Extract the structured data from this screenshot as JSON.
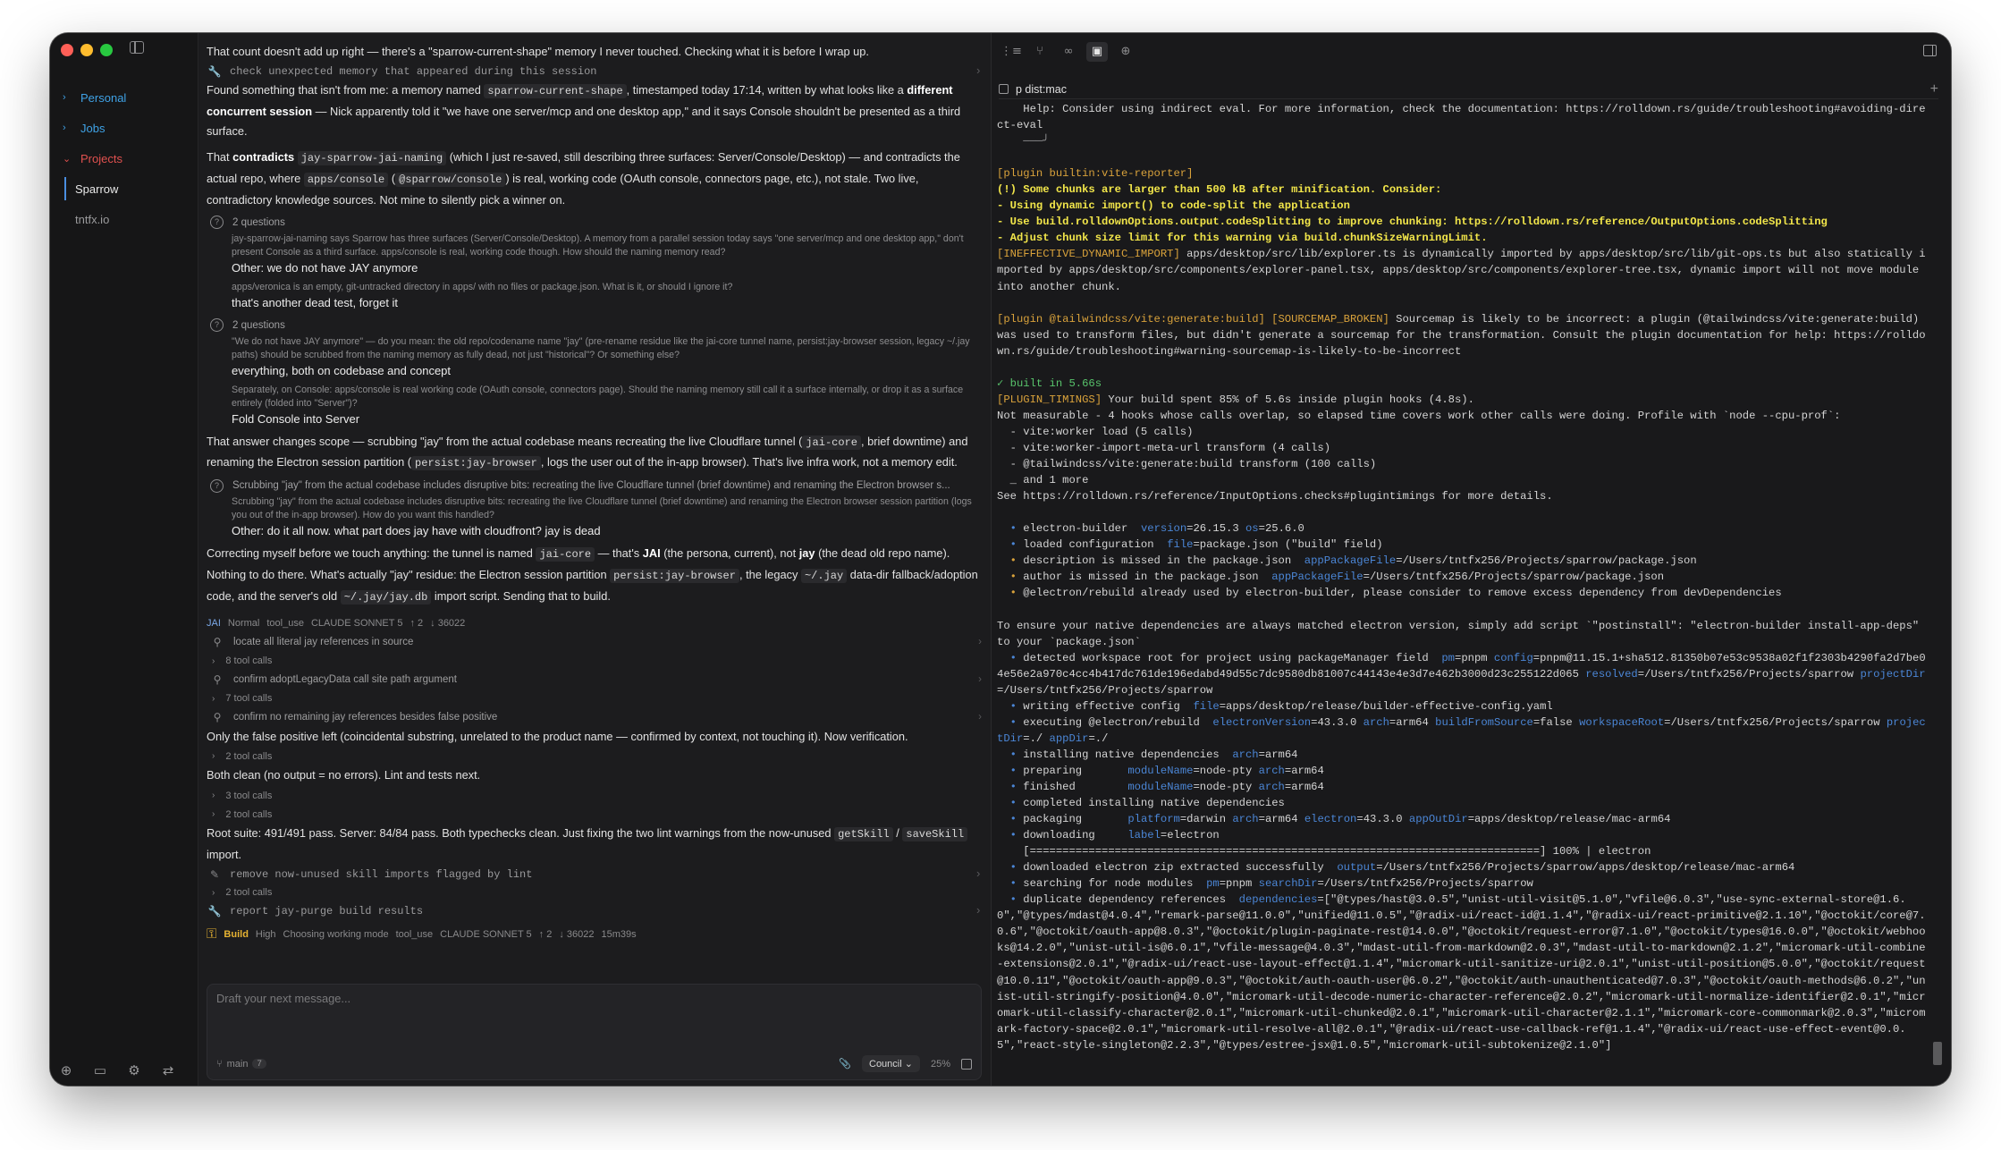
{
  "sidebar": {
    "items": [
      {
        "label": "Personal"
      },
      {
        "label": "Jobs"
      },
      {
        "label": "Projects"
      }
    ],
    "projects": [
      {
        "label": "Sparrow"
      },
      {
        "label": "tntfx.io"
      }
    ]
  },
  "chat": {
    "p1": "That count doesn't add up right — there's a \"sparrow-current-shape\" memory I never touched. Checking what it is before I wrap up.",
    "tool1": "check unexpected memory that appeared during this session",
    "p2a": "Found something that isn't from me: a memory named ",
    "p2code": "sparrow-current-shape",
    "p2b": ", timestamped today 17:14, written by what looks like a ",
    "p2bold": "different concurrent session",
    "p2c": " — Nick apparently told it \"we have one server/mcp and one desktop app,\" and it says Console shouldn't be presented as a third surface.",
    "p3a": "That ",
    "p3bold": "contradicts",
    "p3code1": "jay-sparrow-jai-naming",
    "p3b": " (which I just re-saved, still describing three surfaces: Server/Console/Desktop) — and contradicts the actual repo, where ",
    "p3code2": "apps/console",
    "p3c": " (",
    "p3code3": "@sparrow/console",
    "p3d": ") is real, working code (OAuth console, connectors page, etc.), not stale. Two live, contradictory knowledge sources. Not mine to silently pick a winner on.",
    "q1_head": "2 questions",
    "q1a_text": "jay-sparrow-jai-naming says Sparrow has three surfaces (Server/Console/Desktop). A memory from a parallel session today says \"one server/mcp and one desktop app,\" don't present Console as a third surface. apps/console is real, working code though. How should the naming memory read?",
    "q1a_ans": "Other: we do not have JAY anymore",
    "q1b_text": "apps/veronica is an empty, git-untracked directory in apps/ with no files or package.json. What is it, or should I ignore it?",
    "q1b_ans": "that's another dead test, forget it",
    "q2_head": "2 questions",
    "q2a_text": "\"We do not have JAY anymore\" — do you mean: the old repo/codename name \"jay\" (pre-rename residue like the jai-core tunnel name, persist:jay-browser session, legacy ~/.jay paths) should be scrubbed from the naming memory as fully dead, not just \"historical\"? Or something else?",
    "q2a_ans": "everything, both on codebase and concept",
    "q2b_text": "Separately, on Console: apps/console is real working code (OAuth console, connectors page). Should the naming memory still call it a surface internally, or drop it as a surface entirely (folded into \"Server\")?",
    "q2b_ans": "Fold Console into Server",
    "p4a": "That answer changes scope — scrubbing \"jay\" from the actual codebase means recreating the live Cloudflare tunnel (",
    "p4code1": "jai-core",
    "p4b": ", brief downtime) and renaming the Electron session partition (",
    "p4code2": "persist:jay-browser",
    "p4c": ", logs the user out of the in-app browser). That's live infra work, not a memory edit.",
    "q3_head": "Scrubbing \"jay\" from the actual codebase includes disruptive bits: recreating the live Cloudflare tunnel (brief downtime) and renaming the Electron browser s...",
    "q3_text": "Scrubbing \"jay\" from the actual codebase includes disruptive bits: recreating the live Cloudflare tunnel (brief downtime) and renaming the Electron browser session partition (logs you out of the in-app browser). How do you want this handled?",
    "q3_ans": "Other: do it all now. what part does jay have with cloudfront? jay is dead",
    "p5a": "Correcting myself before we touch anything: the tunnel is named ",
    "p5code": "jai-core",
    "p5b": " — that's ",
    "p5bold1": "JAI",
    "p5c": " (the persona, current), not ",
    "p5bold2": "jay",
    "p5d": " (the dead old repo name).",
    "p6a": "Nothing to do there. What's actually \"jay\" residue: the Electron session partition ",
    "p6code1": "persist:jay-browser",
    "p6b": ", the legacy ",
    "p6code2": "~/.jay",
    "p6c": " data-dir fallback/adoption code, and the server's old ",
    "p6code3": "~/.jay/jay.db",
    "p6d": " import script. Sending that to build.",
    "meta1": [
      "JAI",
      "Normal",
      "tool_use",
      "CLAUDE SONNET 5",
      "↑ 2",
      "↓ 36022"
    ],
    "sub1": "locate all literal jay references in source",
    "cnt1": "8 tool calls",
    "sub2": "confirm adoptLegacyData call site path argument",
    "cnt2": "7 tool calls",
    "sub3": "confirm no remaining jay references besides false positive",
    "p7": "Only the false positive left (coincidental substring, unrelated to the product name — confirmed by context, not touching it). Now verification.",
    "cnt3": "2 tool calls",
    "p8": "Both clean (no output = no errors). Lint and tests next.",
    "cnt4": "3 tool calls",
    "cnt5": "2 tool calls",
    "p9a": "Root suite: 491/491 pass. Server: 84/84 pass. Both typechecks clean. Just fixing the two lint warnings from the now-unused ",
    "p9code1": "getSkill",
    "p9b": " / ",
    "p9code2": "saveSkill",
    "p9c": " import.",
    "tool2": "remove now-unused skill imports flagged by lint",
    "cnt6": "2 tool calls",
    "tool3": "report jay-purge build results",
    "meta2": [
      "Build",
      "High",
      "Choosing working mode",
      "tool_use",
      "CLAUDE SONNET 5",
      "↑ 2",
      "↓ 36022",
      "15m39s"
    ]
  },
  "composer": {
    "placeholder": "Draft your next message...",
    "branch": "main",
    "branch_badge": "7",
    "mode": "Council",
    "percent": "25%"
  },
  "terminal": {
    "tab_title": "p dist:mac",
    "lines": [
      {
        "t": "    Help: Consider using indirect eval. For more information, check the documentation: https://rolldown.rs/guide/troubleshooting#avoiding-direct-eval",
        "c": ""
      },
      {
        "t": "    ───╯",
        "c": "c-dim"
      },
      {
        "t": "",
        "c": ""
      },
      {
        "t": "[plugin builtin:vite-reporter]",
        "c": "c-y"
      },
      {
        "t": "(!) Some chunks are larger than 500 kB after minification. Consider:",
        "c": "c-yb"
      },
      {
        "t": "- Using dynamic import() to code-split the application",
        "c": "c-yb"
      },
      {
        "t": "- Use build.rolldownOptions.output.codeSplitting to improve chunking: https://rolldown.rs/reference/OutputOptions.codeSplitting",
        "c": "c-yb"
      },
      {
        "t": "- Adjust chunk size limit for this warning via build.chunkSizeWarningLimit.",
        "c": "c-yb"
      },
      {
        "t": "[INEFFECTIVE_DYNAMIC_IMPORT] apps/desktop/src/lib/explorer.ts is dynamically imported by apps/desktop/src/lib/git-ops.ts but also statically imported by apps/desktop/src/components/explorer-panel.tsx, apps/desktop/src/components/explorer-tree.tsx, dynamic import will not move module into another chunk.",
        "c": "",
        "p": "[INEFFECTIVE_DYNAMIC_IMPORT]"
      },
      {
        "t": "",
        "c": ""
      },
      {
        "t": "[plugin @tailwindcss/vite:generate:build] [SOURCEMAP_BROKEN] Sourcemap is likely to be incorrect: a plugin (@tailwindcss/vite:generate:build) was used to transform files, but didn't generate a sourcemap for the transformation. Consult the plugin documentation for help: https://rolldown.rs/guide/troubleshooting#warning-sourcemap-is-likely-to-be-incorrect",
        "c": "",
        "p": "[plugin @tailwindcss/vite:generate:build] [SOURCEMAP_BROKEN]"
      },
      {
        "t": "",
        "c": ""
      },
      {
        "t": "✓ built in 5.66s",
        "c": "c-g"
      },
      {
        "t": "[PLUGIN_TIMINGS] Your build spent 85% of 5.6s inside plugin hooks (4.8s).",
        "c": "",
        "p": "[PLUGIN_TIMINGS]"
      },
      {
        "t": "Not measurable - 4 hooks whose calls overlap, so elapsed time covers work other calls were doing. Profile with `node --cpu-prof`:",
        "c": ""
      },
      {
        "t": "  - vite:worker load (5 calls)",
        "c": ""
      },
      {
        "t": "  - vite:worker-import-meta-url transform (4 calls)",
        "c": ""
      },
      {
        "t": "  - @tailwindcss/vite:generate:build transform (100 calls)",
        "c": ""
      },
      {
        "t": "  _ and 1 more",
        "c": ""
      },
      {
        "t": "See https://rolldown.rs/reference/InputOptions.checks#plugintimings for more details.",
        "c": ""
      },
      {
        "t": "",
        "c": ""
      },
      {
        "t": "  • electron-builder  version=26.15.3 os=25.6.0",
        "c": ""
      },
      {
        "t": "  • loaded configuration  file=package.json (\"build\" field)",
        "c": ""
      },
      {
        "t": "  • description is missed in the package.json  appPackageFile=/Users/tntfx256/Projects/sparrow/package.json",
        "c": ""
      },
      {
        "t": "  • author is missed in the package.json  appPackageFile=/Users/tntfx256/Projects/sparrow/package.json",
        "c": ""
      },
      {
        "t": "  • @electron/rebuild already used by electron-builder, please consider to remove excess dependency from devDependencies",
        "c": ""
      },
      {
        "t": "",
        "c": ""
      },
      {
        "t": "To ensure your native dependencies are always matched electron version, simply add script `\"postinstall\": \"electron-builder install-app-deps\" to your `package.json`",
        "c": ""
      },
      {
        "t": "  • detected workspace root for project using packageManager field  pm=pnpm config=pnpm@11.15.1+sha512.81350b07e53c9538a02f1f2303b4290fa2d7be04e56e2a970c4cc4b417dc761de196edabd49d55c7dc9580db81007c44143e4e3d7e462b3000d23c255122d065 resolved=/Users/tntfx256/Projects/sparrow projectDir=/Users/tntfx256/Projects/sparrow",
        "c": ""
      },
      {
        "t": "  • writing effective config  file=apps/desktop/release/builder-effective-config.yaml",
        "c": ""
      },
      {
        "t": "  • executing @electron/rebuild  electronVersion=43.3.0 arch=arm64 buildFromSource=false workspaceRoot=/Users/tntfx256/Projects/sparrow projectDir=./ appDir=./",
        "c": ""
      },
      {
        "t": "  • installing native dependencies  arch=arm64",
        "c": ""
      },
      {
        "t": "  • preparing       moduleName=node-pty arch=arm64",
        "c": ""
      },
      {
        "t": "  • finished        moduleName=node-pty arch=arm64",
        "c": ""
      },
      {
        "t": "  • completed installing native dependencies",
        "c": ""
      },
      {
        "t": "  • packaging       platform=darwin arch=arm64 electron=43.3.0 appOutDir=apps/desktop/release/mac-arm64",
        "c": ""
      },
      {
        "t": "  • downloading     label=electron",
        "c": ""
      },
      {
        "t": "    [==============================================================================] 100% | electron",
        "c": ""
      },
      {
        "t": "  • downloaded electron zip extracted successfully  output=/Users/tntfx256/Projects/sparrow/apps/desktop/release/mac-arm64",
        "c": ""
      },
      {
        "t": "  • searching for node modules  pm=pnpm searchDir=/Users/tntfx256/Projects/sparrow",
        "c": ""
      },
      {
        "t": "  • duplicate dependency references  dependencies=[\"@types/hast@3.0.5\",\"unist-util-visit@5.1.0\",\"vfile@6.0.3\",\"use-sync-external-store@1.6.0\",\"@types/mdast@4.0.4\",\"remark-parse@11.0.0\",\"unified@11.0.5\",\"@radix-ui/react-id@1.1.4\",\"@radix-ui/react-primitive@2.1.10\",\"@octokit/core@7.0.6\",\"@octokit/oauth-app@8.0.3\",\"@octokit/plugin-paginate-rest@14.0.0\",\"@octokit/request-error@7.1.0\",\"@octokit/types@16.0.0\",\"@octokit/webhooks@14.2.0\",\"unist-util-is@6.0.1\",\"vfile-message@4.0.3\",\"mdast-util-from-markdown@2.0.3\",\"mdast-util-to-markdown@2.1.2\",\"micromark-util-combine-extensions@2.0.1\",\"@radix-ui/react-use-layout-effect@1.1.4\",\"micromark-util-sanitize-uri@2.0.1\",\"unist-util-position@5.0.0\",\"@octokit/request@10.0.11\",\"@octokit/oauth-app@9.0.3\",\"@octokit/auth-oauth-user@6.0.2\",\"@octokit/auth-unauthenticated@7.0.3\",\"@octokit/oauth-methods@6.0.2\",\"unist-util-stringify-position@4.0.0\",\"micromark-util-decode-numeric-character-reference@2.0.2\",\"micromark-util-normalize-identifier@2.0.1\",\"micromark-util-classify-character@2.0.1\",\"micromark-util-chunked@2.0.1\",\"micromark-util-character@2.1.1\",\"micromark-core-commonmark@2.0.3\",\"micromark-factory-space@2.0.1\",\"micromark-util-resolve-all@2.0.1\",\"@radix-ui/react-use-callback-ref@1.1.4\",\"@radix-ui/react-use-effect-event@0.0.5\",\"react-style-singleton@2.2.3\",\"@types/estree-jsx@1.0.5\",\"micromark-util-subtokenize@2.1.0\"]",
        "c": ""
      }
    ]
  },
  "colors": {
    "accent": "#3fa2e6",
    "projects": "#e1514f",
    "warning": "#f2e64a",
    "success": "#58c36b",
    "key": "#4b86d6"
  }
}
